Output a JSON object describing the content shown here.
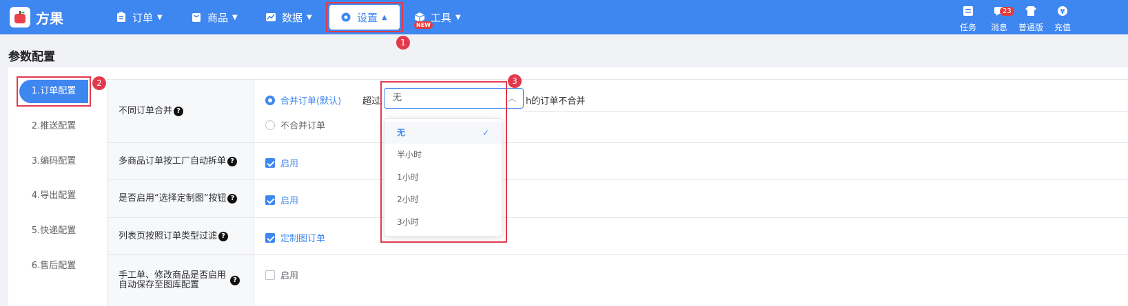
{
  "app": {
    "name": "方果"
  },
  "nav": [
    {
      "label": "订单",
      "icon": "clipboard-icon"
    },
    {
      "label": "商品",
      "icon": "bag-icon"
    },
    {
      "label": "数据",
      "icon": "chart-icon"
    },
    {
      "label": "设置",
      "icon": "gear-icon",
      "active": true
    },
    {
      "label": "工具",
      "icon": "box-icon",
      "badge": "NEW"
    }
  ],
  "tools": [
    {
      "label": "任务",
      "icon": "tasks-icon"
    },
    {
      "label": "消息",
      "icon": "message-icon",
      "count": "23"
    },
    {
      "label": "普通版",
      "icon": "shirt-icon"
    },
    {
      "label": "充值",
      "icon": "yuan-icon"
    }
  ],
  "annotations": [
    "1",
    "2",
    "3"
  ],
  "page_title": "参数配置",
  "sidebar": [
    {
      "label": "1.订单配置",
      "active": true
    },
    {
      "label": "2.推送配置"
    },
    {
      "label": "3.编码配置"
    },
    {
      "label": "4.导出配置"
    },
    {
      "label": "5.快递配置"
    },
    {
      "label": "6.售后配置"
    }
  ],
  "settings": {
    "merge": {
      "label": "不同订单合并",
      "option_merge": "合并订单(默认)",
      "prefix": "超过",
      "select_value": "无",
      "suffix": "h的订单不合并",
      "option_no_merge": "不合并订单"
    },
    "split": {
      "label": "多商品订单按工厂自动拆单",
      "option": "启用",
      "checked": true
    },
    "custom_btn": {
      "label": "是否启用“选择定制图”按钮",
      "option": "启用",
      "checked": true
    },
    "filter": {
      "label": "列表页按照订单类型过滤",
      "option": "定制图订单",
      "checked": true
    },
    "autosave": {
      "label_line1": "手工单、修改商品是否启用",
      "label_line2": "自动保存至图库配置",
      "option": "启用",
      "checked": false
    }
  },
  "dropdown": {
    "options": [
      "无",
      "半小时",
      "1小时",
      "2小时",
      "3小时"
    ],
    "selected": "无"
  },
  "colors": {
    "primary": "#3e86f0",
    "annotation": "#e23a4c"
  }
}
